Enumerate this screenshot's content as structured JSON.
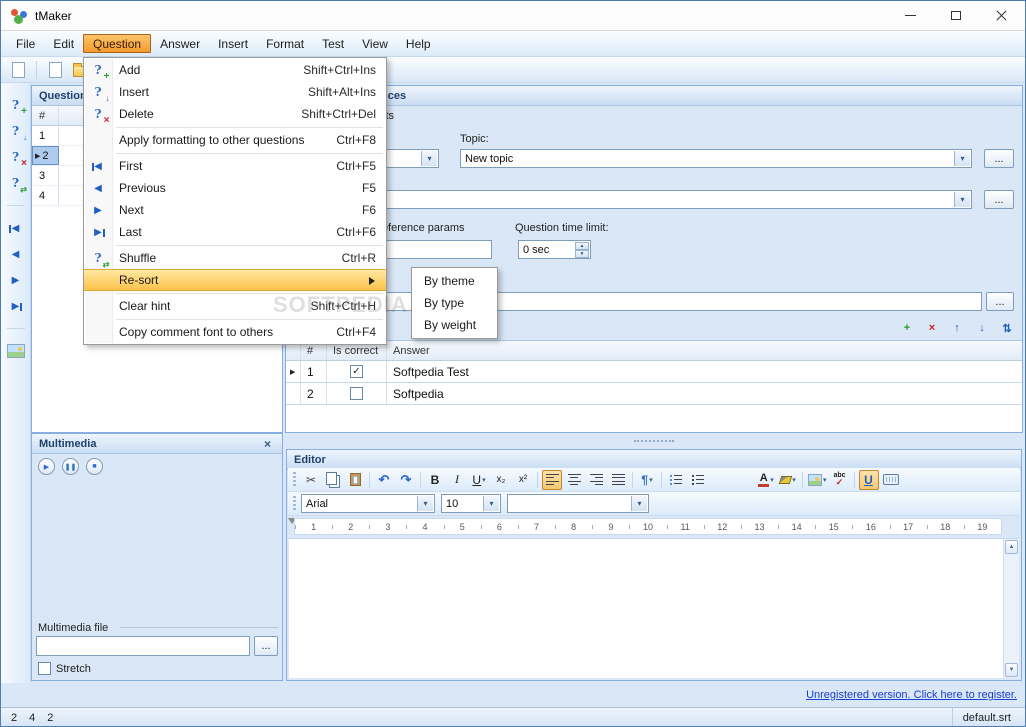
{
  "window": {
    "title": "tMaker"
  },
  "menubar": {
    "items": [
      "File",
      "Edit",
      "Question",
      "Answer",
      "Insert",
      "Format",
      "Test",
      "View",
      "Help"
    ]
  },
  "question_menu": {
    "items": [
      {
        "label": "Add",
        "shortcut": "Shift+Ctrl+Ins"
      },
      {
        "label": "Insert",
        "shortcut": "Shift+Alt+Ins"
      },
      {
        "label": "Delete",
        "shortcut": "Shift+Ctrl+Del"
      },
      {
        "label": "Apply formatting to other questions",
        "shortcut": "Ctrl+F8"
      },
      {
        "label": "First",
        "shortcut": "Ctrl+F5"
      },
      {
        "label": "Previous",
        "shortcut": "F5"
      },
      {
        "label": "Next",
        "shortcut": "F6"
      },
      {
        "label": "Last",
        "shortcut": "Ctrl+F6"
      },
      {
        "label": "Shuffle",
        "shortcut": "Ctrl+R"
      },
      {
        "label": "Re-sort",
        "shortcut": ""
      },
      {
        "label": "Clear hint",
        "shortcut": "Shift+Ctrl+H"
      },
      {
        "label": "Copy comment font to others",
        "shortcut": "Ctrl+F4"
      }
    ]
  },
  "resort_submenu": {
    "items": [
      "By theme",
      "By type",
      "By weight"
    ]
  },
  "questions_panel": {
    "title": "Questions",
    "col_header": "#",
    "rows": [
      "1",
      "2",
      "3",
      "4"
    ],
    "selected_marker": "▶"
  },
  "preferences": {
    "title": "Question preferences",
    "contents_label": "Contents",
    "topic_label": "Topic:",
    "topic_value": "New topic",
    "browse_label": "...",
    "reference_label": "Reference params",
    "time_limit_label": "Question time limit:",
    "time_limit_value": "0 sec"
  },
  "answers": {
    "columns": [
      "#",
      "Is correct",
      "Answer"
    ],
    "selected_marker": "▶",
    "rows": [
      {
        "num": "1",
        "check": "✓",
        "answer": "Softpedia Test"
      },
      {
        "num": "2",
        "check": "",
        "answer": "Softpedia"
      }
    ]
  },
  "editor": {
    "title": "Editor",
    "font_value": "Arial",
    "size_value": "10",
    "style_value": "",
    "bold": "B",
    "italic": "I",
    "underline": "U",
    "subscript": "x₂",
    "superscript": "x²",
    "paragraph": "¶",
    "underline_toggle": "U",
    "ruler": [
      "1",
      "2",
      "3",
      "4",
      "5",
      "6",
      "7",
      "8",
      "9",
      "10",
      "11",
      "12",
      "13",
      "14",
      "15",
      "16",
      "17",
      "18",
      "19"
    ]
  },
  "multimedia": {
    "title": "Multimedia",
    "file_label": "Multimedia file",
    "file_value": "",
    "stretch_label": "Stretch"
  },
  "footer": {
    "register_link": "Unregistered version. Click here to register.",
    "counts": [
      "2",
      "4",
      "2"
    ],
    "file_name": "default.srt"
  },
  "watermark": "SOFTPEDIA",
  "colors": {
    "accent_orange": "#f49b2e",
    "selection_blue": "#aecbee",
    "link_blue": "#1b3fce"
  }
}
